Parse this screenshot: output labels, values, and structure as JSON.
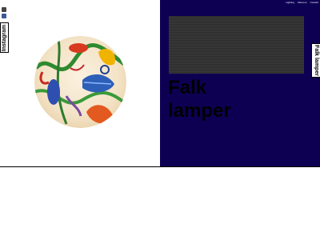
{
  "social": {
    "icons": [
      "instagram-icon",
      "facebook-icon"
    ],
    "instagram_tab_label": "Instagram"
  },
  "nav": {
    "items": [
      "Lighting",
      "About us",
      "Contact"
    ]
  },
  "hero": {
    "title": "Falk lamper",
    "side_tab_label": "Falk lamper"
  },
  "colors": {
    "right_panel_bg": "#0d0053",
    "left_panel_bg": "#ffffff"
  }
}
